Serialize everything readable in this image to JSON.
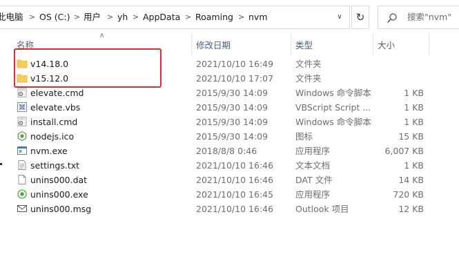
{
  "address": {
    "crumbs": [
      "此电脑",
      "OS (C:)",
      "用户",
      "yh",
      "AppData",
      "Roaming",
      "nvm"
    ]
  },
  "search": {
    "placeholder": "搜索\"nvm\""
  },
  "columns": {
    "name": "名称",
    "date": "修改日期",
    "type": "类型",
    "size": "大小"
  },
  "files": [
    {
      "name": "v14.18.0",
      "date": "2021/10/10 16:49",
      "type": "文件夹",
      "size": "",
      "icon": "folder-icon"
    },
    {
      "name": "v15.12.0",
      "date": "2021/10/10 17:07",
      "type": "文件夹",
      "size": "",
      "icon": "folder-icon"
    },
    {
      "name": "elevate.cmd",
      "date": "2015/9/30 14:09",
      "type": "Windows 命令脚本",
      "size": "1 KB",
      "icon": "cmd-script-icon"
    },
    {
      "name": "elevate.vbs",
      "date": "2015/9/30 14:09",
      "type": "VBScript Script ...",
      "size": "1 KB",
      "icon": "vbs-script-icon"
    },
    {
      "name": "install.cmd",
      "date": "2015/9/30 14:09",
      "type": "Windows 命令脚本",
      "size": "1 KB",
      "icon": "cmd-script-icon"
    },
    {
      "name": "nodejs.ico",
      "date": "2015/9/30 14:09",
      "type": "图标",
      "size": "15 KB",
      "icon": "nodejs-icon"
    },
    {
      "name": "nvm.exe",
      "date": "2018/8/8 0:46",
      "type": "应用程序",
      "size": "6,007 KB",
      "icon": "exe-icon"
    },
    {
      "name": "settings.txt",
      "date": "2021/10/10 16:46",
      "type": "文本文档",
      "size": "1 KB",
      "icon": "text-file-icon"
    },
    {
      "name": "unins000.dat",
      "date": "2021/10/10 16:46",
      "type": "DAT 文件",
      "size": "14 KB",
      "icon": "file-icon"
    },
    {
      "name": "unins000.exe",
      "date": "2021/10/10 16:45",
      "type": "应用程序",
      "size": "720 KB",
      "icon": "uninstaller-icon"
    },
    {
      "name": "unins000.msg",
      "date": "2021/10/10 16:46",
      "type": "Outlook 项目",
      "size": "12 KB",
      "icon": "mail-icon"
    }
  ],
  "colors": {
    "highlight": "#e02b2b",
    "folder": "#f7cd56",
    "header_text": "#4c607a"
  }
}
